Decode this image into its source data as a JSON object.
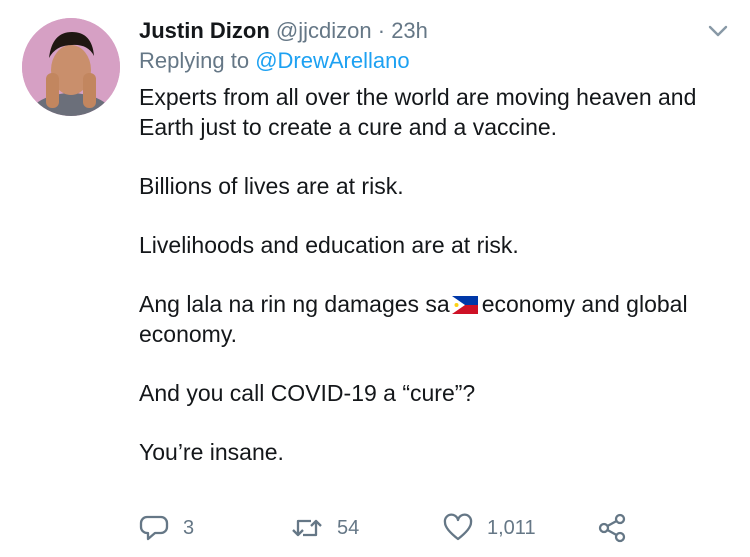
{
  "tweet": {
    "author_name": "Justin Dizon",
    "handle": "@jjcdizon",
    "separator": "·",
    "time": "23h",
    "reply_prefix": "Replying to",
    "reply_to": "@DrewArellano",
    "paragraphs": [
      "Experts from all over the world are moving heaven and Earth just to create a cure and a vaccine.",
      "Billions of lives are at risk.",
      "Livelihoods and education are at risk."
    ],
    "para4_before_flag": "Ang lala na rin ng damages sa",
    "para4_after_flag": "economy and global economy.",
    "para5": "And you call COVID-19 a “cure”?",
    "para6": "You’re insane.",
    "flag_icon": "philippines-flag-icon"
  },
  "actions": {
    "replies": "3",
    "retweets": "54",
    "likes": "1,011"
  },
  "colors": {
    "text": "#14171a",
    "secondary": "#657786",
    "link": "#1da1f2"
  }
}
